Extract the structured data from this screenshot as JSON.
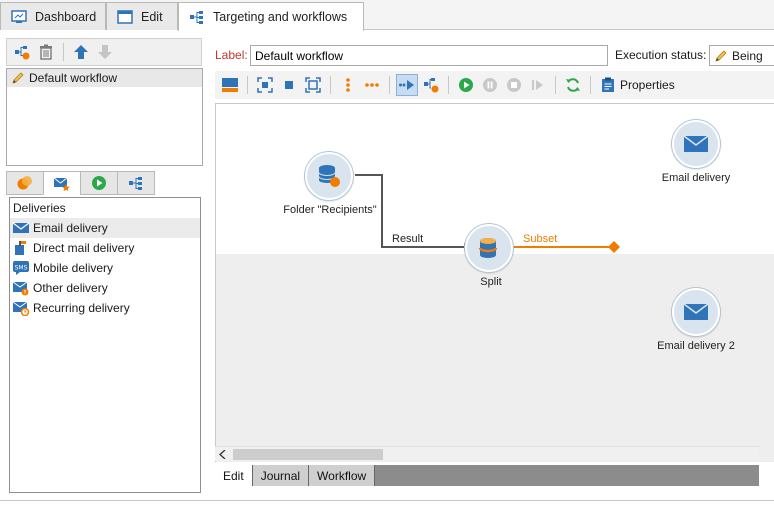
{
  "tabs": [
    {
      "label": "Dashboard",
      "icon": "dashboard-icon"
    },
    {
      "label": "Edit",
      "icon": "edit-window-icon"
    },
    {
      "label": "Targeting and workflows",
      "icon": "workflow-icon",
      "active": true
    }
  ],
  "workflow_list": {
    "items": [
      {
        "label": "Default workflow",
        "icon": "pencil-icon"
      }
    ]
  },
  "palette": {
    "header": "Deliveries",
    "items": [
      {
        "label": "Email delivery",
        "icon": "email-icon"
      },
      {
        "label": "Direct mail delivery",
        "icon": "direct-mail-icon"
      },
      {
        "label": "Mobile delivery",
        "icon": "sms-icon"
      },
      {
        "label": "Other delivery",
        "icon": "other-delivery-icon"
      },
      {
        "label": "Recurring delivery",
        "icon": "recurring-delivery-icon"
      }
    ]
  },
  "form": {
    "label_caption": "Label:",
    "label_value": "Default workflow",
    "status_caption": "Execution status:",
    "status_value": "Being"
  },
  "toolbar": {
    "properties_label": "Properties"
  },
  "canvas": {
    "nodes": [
      {
        "label": "Folder \"Recipients\"",
        "icon": "database-icon"
      },
      {
        "label": "Split",
        "icon": "split-icon"
      },
      {
        "label": "Email delivery",
        "icon": "email-icon"
      },
      {
        "label": "Email delivery 2",
        "icon": "email-icon"
      }
    ],
    "transitions": [
      {
        "label": "Result"
      },
      {
        "label": "Subset"
      }
    ]
  },
  "bottom_tabs": [
    {
      "label": "Edit",
      "active": true
    },
    {
      "label": "Journal"
    },
    {
      "label": "Workflow"
    }
  ],
  "colors": {
    "accent_orange": "#f07c00",
    "node_blue": "#2f73b8",
    "run_green": "#2aa84a"
  }
}
